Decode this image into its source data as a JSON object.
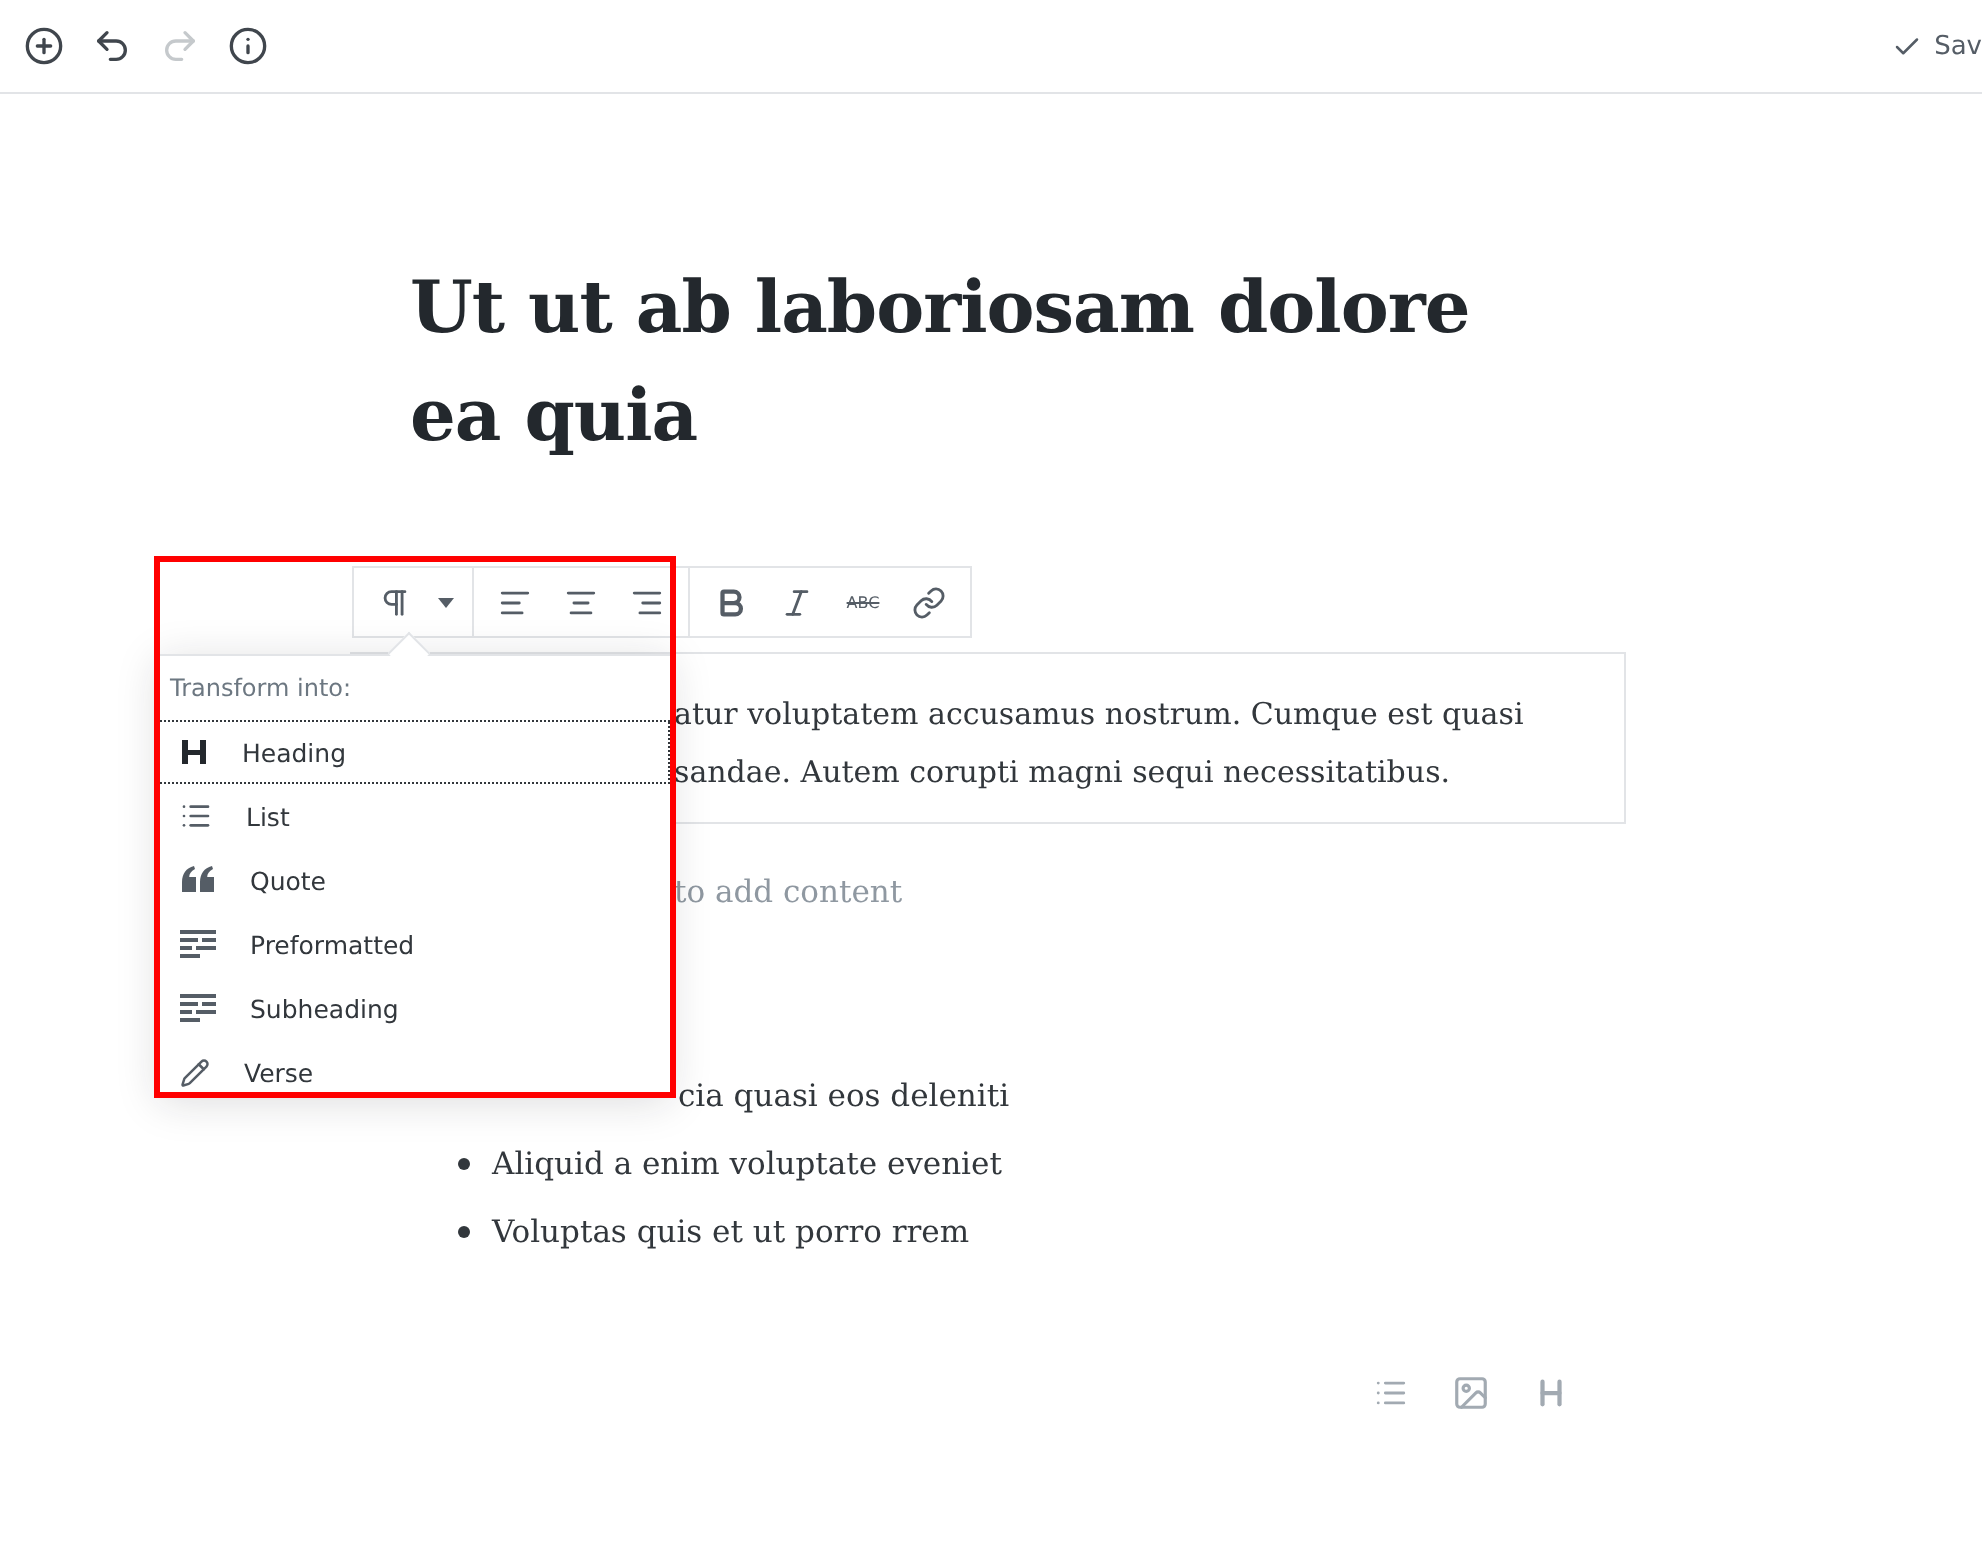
{
  "header": {
    "buttons": [
      {
        "kind": "add",
        "disabled": false
      },
      {
        "kind": "undo",
        "disabled": false
      },
      {
        "kind": "redo",
        "disabled": true
      },
      {
        "kind": "info",
        "disabled": false
      }
    ],
    "save_label": "Sav"
  },
  "post": {
    "title": "Ut ut ab laboriosam dolore ea quia",
    "paragraph_lines": [
      "atur voluptatem accusamus nostrum. Cumque est quasi",
      "sandae. Autem corupti magni sequi necessitatibus."
    ],
    "placeholder": "to add content",
    "list_items": [
      {
        "text": "cia quasi eos deleniti",
        "bullet_visible": false
      },
      {
        "text": "Aliquid a enim voluptate eveniet",
        "bullet_visible": true
      },
      {
        "text": "Voluptas quis et ut porro rrem",
        "bullet_visible": true
      }
    ]
  },
  "toolbar": {
    "groups": [
      [
        {
          "kind": "paragraph"
        },
        {
          "kind": "caret"
        }
      ],
      [
        {
          "kind": "align-left"
        },
        {
          "kind": "align-center"
        },
        {
          "kind": "align-right"
        }
      ],
      [
        {
          "kind": "bold"
        },
        {
          "kind": "italic"
        },
        {
          "kind": "strike",
          "label": "ABC"
        },
        {
          "kind": "link"
        }
      ]
    ]
  },
  "transform_menu": {
    "title": "Transform into:",
    "items": [
      {
        "label": "Heading",
        "kind": "heading",
        "selected": true
      },
      {
        "label": "List",
        "kind": "list",
        "selected": false
      },
      {
        "label": "Quote",
        "kind": "quote",
        "selected": false
      },
      {
        "label": "Preformatted",
        "kind": "lines",
        "selected": false
      },
      {
        "label": "Subheading",
        "kind": "lines",
        "selected": false
      },
      {
        "label": "Verse",
        "kind": "pencil",
        "selected": false
      }
    ]
  },
  "inserter": [
    {
      "kind": "list"
    },
    {
      "kind": "image"
    },
    {
      "kind": "heading"
    }
  ]
}
